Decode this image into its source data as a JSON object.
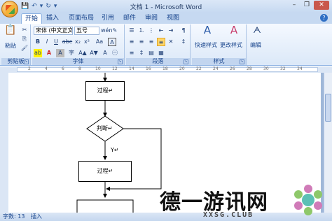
{
  "window": {
    "title": "文档 1 - Microsoft Word",
    "minimize": "–",
    "maximize": "❐",
    "close": "✕"
  },
  "qat": {
    "save": "💾",
    "undo": "↶",
    "undo_drop": "▾",
    "redo": "↻",
    "more": "▾"
  },
  "tabs": [
    {
      "label": "开始",
      "active": true
    },
    {
      "label": "插入"
    },
    {
      "label": "页面布局"
    },
    {
      "label": "引用"
    },
    {
      "label": "邮件"
    },
    {
      "label": "审阅"
    },
    {
      "label": "视图"
    }
  ],
  "help": "?",
  "ribbon": {
    "clipboard": {
      "label": "剪贴板",
      "paste": "粘贴",
      "cut": "✂",
      "copy": "⎘",
      "format_painter": "🖌"
    },
    "font": {
      "label": "字体",
      "font_name": "宋体 (中文正文)",
      "font_size": "五号",
      "grow": "A▲",
      "shrink": "A▼",
      "clear": "✎",
      "phonetic": "wén",
      "border_char": "A",
      "bold": "B",
      "italic": "I",
      "underline": "U",
      "strike": "abc",
      "sub": "x₂",
      "sup": "x²",
      "change_case": "Aa",
      "highlight": "ab",
      "font_color": "A",
      "shading": "A",
      "enclose": "字",
      "scale": "A",
      "enclose2": "㊀"
    },
    "paragraph": {
      "label": "段落",
      "bullets": "☰",
      "numbering": "⒈",
      "multilevel": "⋮",
      "decrease_indent": "⇤",
      "increase_indent": "⇥",
      "chinese_layout": "✕",
      "sort": "↕",
      "show_marks": "¶",
      "align_left": "≡",
      "align_center": "≡",
      "align_right": "≡",
      "justify": "≡",
      "distribute": "≡",
      "line_spacing": "↕",
      "shading": "▤",
      "borders": "▦"
    },
    "styles": {
      "label": "样式",
      "quick": "快速样式",
      "change": "更改样式"
    },
    "editing": {
      "label": "编辑",
      "find": "编辑"
    }
  },
  "ruler_marks": [
    "2",
    "4",
    "6",
    "8",
    "10",
    "12",
    "14",
    "16",
    "18",
    "20",
    "22",
    "24",
    "26",
    "28",
    "30",
    "32",
    "34"
  ],
  "flowchart": {
    "process1": "过程↵",
    "decision": "判断↵",
    "yes_label": "Y↵",
    "process2": "过程↵"
  },
  "status": {
    "word_count": "字数: 13",
    "mode": "插入"
  },
  "watermark": {
    "text": "德一游讯网",
    "sub": "XXSG.CLUB"
  },
  "colors": {
    "ribbon_bg": "#dbe8f8",
    "accent": "#15428b",
    "highlight": "#ffd76b"
  }
}
